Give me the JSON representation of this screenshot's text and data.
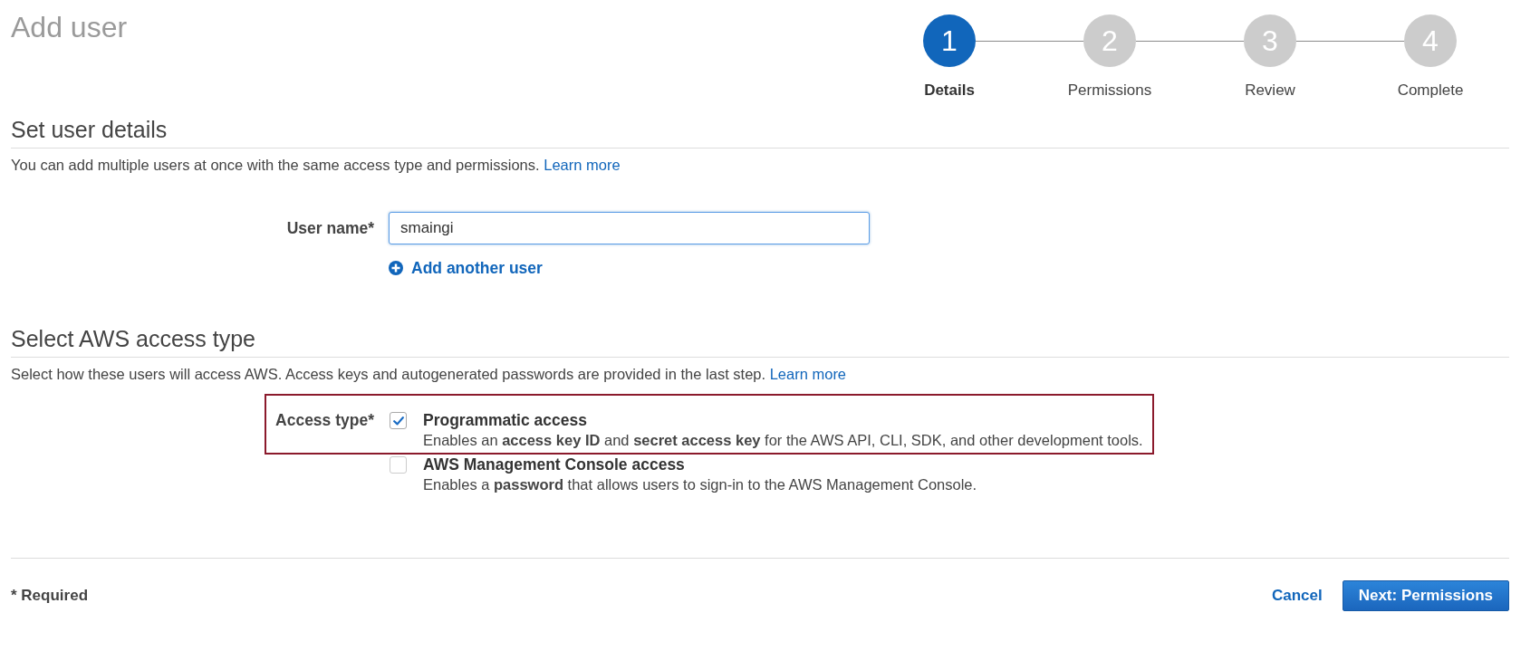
{
  "page": {
    "title": "Add user"
  },
  "steps": [
    {
      "number": "1",
      "label": "Details",
      "selected": true
    },
    {
      "number": "2",
      "label": "Permissions",
      "selected": false
    },
    {
      "number": "3",
      "label": "Review",
      "selected": false
    },
    {
      "number": "4",
      "label": "Complete",
      "selected": false
    }
  ],
  "user_details": {
    "heading": "Set user details",
    "description": "You can add multiple users at once with the same access type and permissions.",
    "learn_more": "Learn more",
    "user_name": {
      "label": "User name*",
      "value": "smaingi"
    },
    "add_another_user": "Add another user"
  },
  "access_type": {
    "heading": "Select AWS access type",
    "description": "Select how these users will access AWS. Access keys and autogenerated passwords are provided in the last step.",
    "learn_more": "Learn more",
    "label": "Access type*",
    "options": [
      {
        "title": "Programmatic access",
        "description": "Enables an **access key ID** and **secret access key** for the AWS API, CLI, SDK, and other development tools.",
        "checked": true,
        "highlighted": true
      },
      {
        "title": "AWS Management Console access",
        "description": "Enables a **password** that allows users to sign-in to the AWS Management Console.",
        "checked": false,
        "highlighted": false
      }
    ]
  },
  "footer": {
    "required_note": "* Required",
    "cancel": "Cancel",
    "next": "Next: Permissions"
  }
}
